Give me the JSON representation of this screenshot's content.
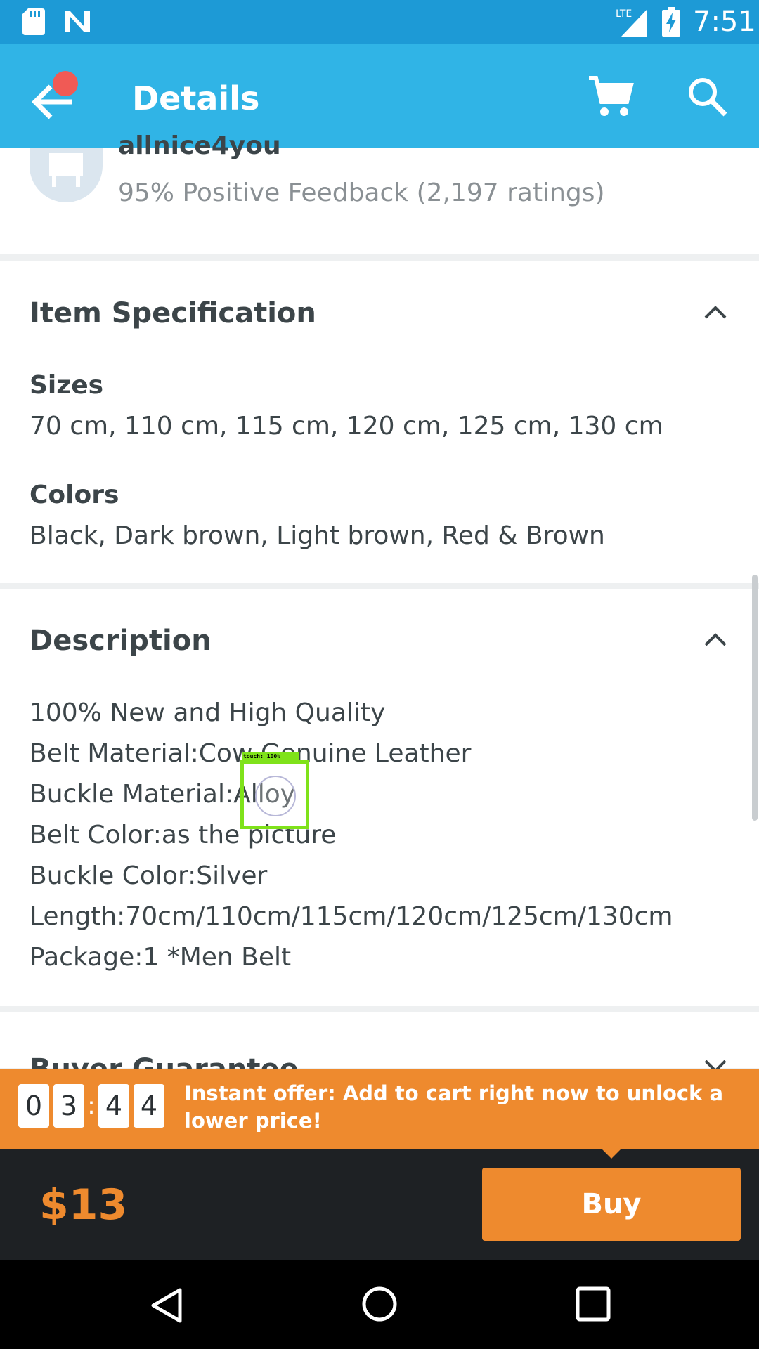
{
  "status_bar": {
    "time": "7:51",
    "network_label": "LTE",
    "icons": [
      "sd-card-icon",
      "n-notification-icon",
      "lte-signal-icon",
      "battery-charging-icon"
    ]
  },
  "app_bar": {
    "title": "Details",
    "back_icon": "back-arrow-icon",
    "cart_icon": "cart-icon",
    "search_icon": "search-icon",
    "accent_color": "#30b4e6",
    "notification_dot_color": "#f05a55"
  },
  "store": {
    "name": "allnice4you",
    "feedback": "95% Positive Feedback (2,197 ratings)"
  },
  "item_specification": {
    "title": "Item Specification",
    "expanded": true,
    "fields": [
      {
        "label": "Sizes",
        "value": "70 cm, 110 cm, 115 cm, 120 cm, 125 cm, 130 cm"
      },
      {
        "label": "Colors",
        "value": "Black, Dark brown, Light brown, Red & Brown"
      }
    ]
  },
  "description": {
    "title": "Description",
    "expanded": true,
    "lines": [
      "100% New and High Quality",
      "Belt Material:Cow Genuine Leather",
      "Buckle Material:Alloy",
      "Belt Color:as the picture",
      "Buckle Color:Silver",
      "Length:70cm/110cm/115cm/120cm/125cm/130cm",
      "Package:1 *Men Belt"
    ]
  },
  "buyer_guarantee": {
    "title": "Buyer Guarantee",
    "expanded": false
  },
  "offer": {
    "countdown": [
      "0",
      "3",
      "4",
      "4"
    ],
    "separator": ":",
    "text": "Instant offer: Add to cart right now to unlock a lower price!",
    "color": "#ee8a2e"
  },
  "purchase": {
    "price": "$13",
    "buy_label": "Buy"
  },
  "touch_overlay": {
    "label": "touch: 100%"
  },
  "nav_bar": {
    "icons": [
      "nav-back-icon",
      "nav-home-icon",
      "nav-recents-icon"
    ]
  }
}
